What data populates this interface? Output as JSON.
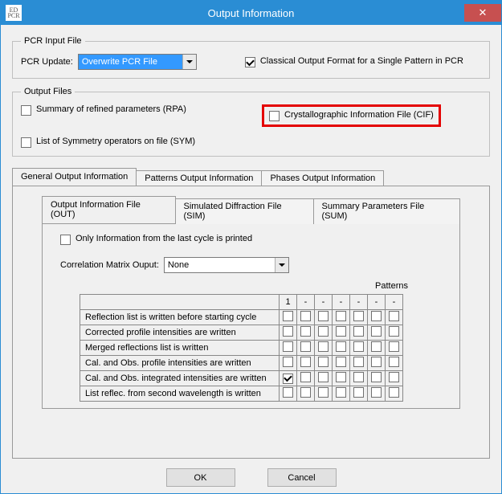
{
  "window": {
    "title": "Output Information",
    "icon_text_top": "ED",
    "icon_text_bot": "PCR"
  },
  "pcr_input": {
    "legend": "PCR Input File",
    "update_label": "PCR Update:",
    "update_value": "Overwrite PCR File",
    "classical_label": "Classical Output Format for a Single Pattern in PCR"
  },
  "output_files": {
    "legend": "Output Files",
    "summary_label": "Summary of refined parameters (RPA)",
    "cif_label": "Crystallographic Information File (CIF)",
    "sym_label": "List of Symmetry operators on file (SYM)"
  },
  "tabs_main": {
    "general": "General Output Information",
    "patterns": "Patterns Output Information",
    "phases": "Phases Output Information"
  },
  "tabs_inner": {
    "out": "Output Information File (OUT)",
    "sim": "Simulated Diffraction File (SIM)",
    "sum": "Summary Parameters File (SUM)"
  },
  "general": {
    "only_last_cycle": "Only Information from the last cycle is printed",
    "corr_label": "Correlation Matrix Ouput:",
    "corr_value": "None",
    "patterns_heading": "Patterns",
    "col_headers": [
      "1",
      "-",
      "-",
      "-",
      "-",
      "-",
      "-"
    ],
    "rows": [
      {
        "label": "Reflection list is written before starting cycle",
        "checks": [
          false,
          false,
          false,
          false,
          false,
          false,
          false
        ]
      },
      {
        "label": "Corrected profile intensities are written",
        "checks": [
          false,
          false,
          false,
          false,
          false,
          false,
          false
        ]
      },
      {
        "label": "Merged reflections list is written",
        "checks": [
          false,
          false,
          false,
          false,
          false,
          false,
          false
        ]
      },
      {
        "label": "Cal. and Obs. profile intensities are written",
        "checks": [
          false,
          false,
          false,
          false,
          false,
          false,
          false
        ]
      },
      {
        "label": "Cal. and Obs. integrated intensities are written",
        "checks": [
          true,
          false,
          false,
          false,
          false,
          false,
          false
        ]
      },
      {
        "label": "List reflec. from second wavelength is written",
        "checks": [
          false,
          false,
          false,
          false,
          false,
          false,
          false
        ]
      }
    ]
  },
  "buttons": {
    "ok": "OK",
    "cancel": "Cancel"
  }
}
